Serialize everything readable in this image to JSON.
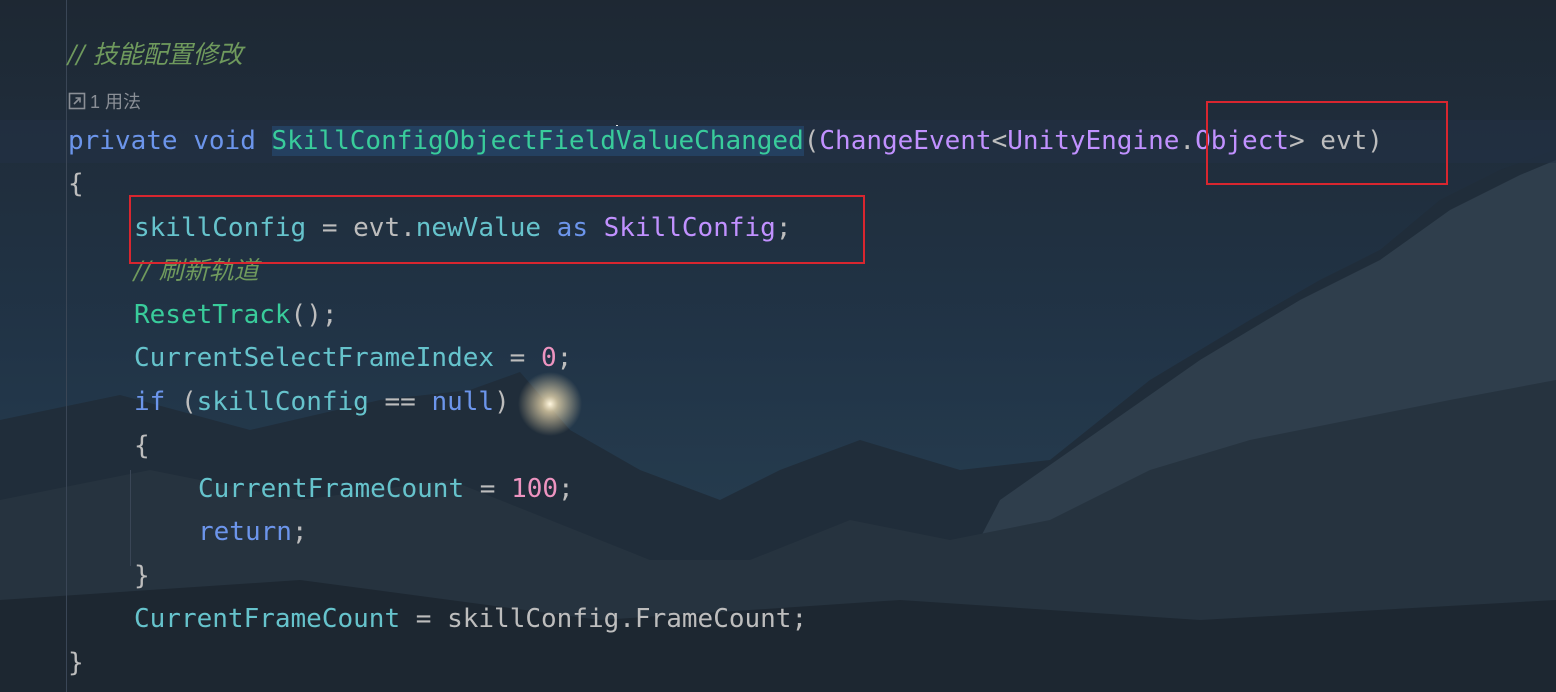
{
  "comments": {
    "config_change": "// 技能配置修改",
    "refresh_track": "// 刷新轨道"
  },
  "usages_hint": {
    "icon": "open-usages-icon",
    "label": "1 用法"
  },
  "signature": {
    "private": "private",
    "void": "void",
    "method_before_caret": "SkillConfigObjectField",
    "method_after_caret": "ValueChanged",
    "open_paren": "(",
    "change_event": "ChangeEvent",
    "lt": "<",
    "unity_engine": "UnityEngine",
    "dot": ".",
    "object": "Object",
    "gt": ">",
    "param": " evt",
    "close_paren": ")"
  },
  "braces": {
    "open": "{",
    "close": "}"
  },
  "assign_line": {
    "var": "skillConfig",
    "op": " = ",
    "evt": "evt",
    "dot": ".",
    "new_value": "newValue",
    "as": "as",
    "type": "SkillConfig",
    "semi": ";"
  },
  "reset_line": {
    "fn": "ResetTrack",
    "rest": "();"
  },
  "index_line": {
    "prop": "CurrentSelectFrameIndex",
    "op": " = ",
    "num": "0",
    "semi": ";"
  },
  "if_line": {
    "if": "if",
    "open": " (",
    "var": "skillConfig",
    "op": " == ",
    "null": "null",
    "close": ")"
  },
  "frame_count_line": {
    "prop": "CurrentFrameCount",
    "op": " = ",
    "num": "100",
    "semi": ";"
  },
  "return_line": {
    "kw": "return",
    "semi": ";"
  },
  "final_line": {
    "prop": "CurrentFrameCount",
    "op": " = ",
    "var": "skillConfig",
    "dot": ".",
    "member": "FrameCount",
    "semi": ";"
  },
  "colors": {
    "keyword": "#6c95eb",
    "method": "#39cc9b",
    "type": "#c191ff",
    "comment": "#6f9a5d",
    "number": "#ed94c0",
    "property": "#66c3cc",
    "annotation_box": "#d8262f"
  }
}
